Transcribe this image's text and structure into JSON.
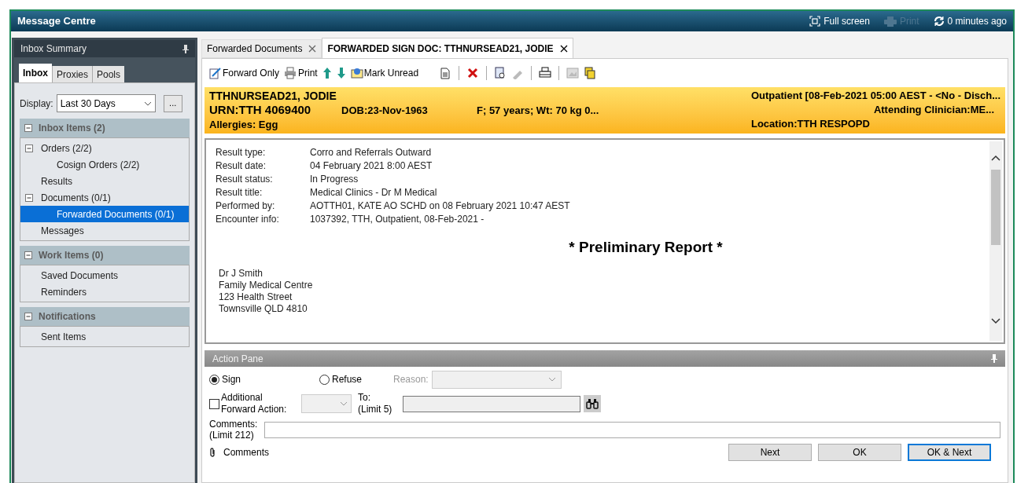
{
  "window": {
    "title": "Message Centre"
  },
  "header_actions": [
    {
      "kind": "fullscreen",
      "label": "Full screen",
      "disabled": false
    },
    {
      "kind": "print",
      "label": "Print",
      "disabled": true
    },
    {
      "kind": "refresh",
      "label": "0 minutes ago",
      "disabled": false
    }
  ],
  "sidebar": {
    "title": "Inbox Summary",
    "tabs": [
      {
        "label": "Inbox",
        "selected": true
      },
      {
        "label": "Proxies",
        "selected": false
      },
      {
        "label": "Pools",
        "selected": false
      }
    ],
    "display": {
      "label": "Display:",
      "value": "Last 30 Days",
      "more": "..."
    },
    "sections": [
      {
        "title": "Inbox Items (2)",
        "expanded": true,
        "items": [
          {
            "label": "Orders (2/2)",
            "selected": false,
            "expanded": true,
            "children": [
              {
                "label": "Cosign Orders (2/2)",
                "selected": false
              }
            ]
          },
          {
            "label": "Results",
            "selected": false
          },
          {
            "label": "Documents (0/1)",
            "selected": false,
            "expanded": true,
            "children": [
              {
                "label": "Forwarded Documents (0/1)",
                "selected": true
              }
            ]
          },
          {
            "label": "Messages",
            "selected": false
          }
        ]
      },
      {
        "title": "Work Items (0)",
        "expanded": true,
        "items": [
          {
            "label": "Saved Documents",
            "selected": false
          },
          {
            "label": "Reminders",
            "selected": false
          }
        ]
      },
      {
        "title": "Notifications",
        "expanded": true,
        "items": [
          {
            "label": "Sent Items",
            "selected": false
          }
        ]
      }
    ]
  },
  "doc_tabs": [
    {
      "label": "Forwarded Documents",
      "selected": false
    },
    {
      "label": "FORWARDED SIGN DOC: TTHNURSEAD21, JODIE",
      "selected": true
    }
  ],
  "toolbar": {
    "forward": "Forward Only",
    "print": "Print",
    "mark_unread": "Mark Unread"
  },
  "banner": {
    "name": "TTHNURSEAD21, JODIE",
    "urn": "URN:TTH 4069400",
    "dob": "DOB:23-Nov-1963",
    "demographics": "F; 57 years; Wt: 70 kg 0...",
    "allergies": "Allergies: Egg",
    "encounter": "Outpatient [08-Feb-2021 05:00 AEST - <No - Disch...",
    "attending": "Attending Clinician:ME...",
    "location": "Location:TTH RESPOPD"
  },
  "report": {
    "fields": [
      {
        "label": "Result type:",
        "value": "Corro and Referrals Outward"
      },
      {
        "label": "Result date:",
        "value": "04 February 2021 8:00 AEST"
      },
      {
        "label": "Result status:",
        "value": "In Progress"
      },
      {
        "label": "Result title:",
        "value": "Medical Clinics - Dr M Medical"
      },
      {
        "label": "Performed by:",
        "value": "AOTTH01, KATE AO SCHD on 08 February 2021 10:47 AEST"
      },
      {
        "label": "Encounter info:",
        "value": "1037392, TTH, Outpatient, 08-Feb-2021 -"
      }
    ],
    "heading": "* Preliminary Report *",
    "address": [
      "Dr J Smith",
      "Family Medical Centre",
      "123 Health Street",
      "Townsville QLD 4810"
    ]
  },
  "action_pane": {
    "title": "Action Pane",
    "options": [
      {
        "label": "Sign",
        "selected": true
      },
      {
        "label": "Refuse",
        "selected": false
      }
    ],
    "reason": {
      "label": "Reason:",
      "disabled": true
    },
    "additional": {
      "label_lines": [
        "Additional",
        "Forward Action:"
      ],
      "checked": false
    },
    "to": {
      "label_lines": [
        "To:",
        "(Limit 5)"
      ]
    },
    "comments": {
      "label_lines": [
        "Comments:",
        "(Limit 212)"
      ]
    },
    "attachment": "Comments",
    "buttons": [
      {
        "label": "Next",
        "selected": false
      },
      {
        "label": "OK",
        "selected": false
      },
      {
        "label": "OK & Next",
        "selected": true
      }
    ]
  }
}
